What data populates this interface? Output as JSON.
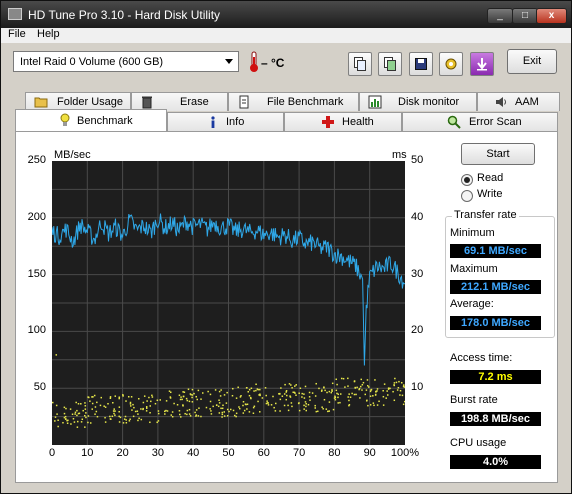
{
  "window": {
    "title": "HD Tune Pro 3.10 - Hard Disk Utility",
    "min": "_",
    "max": "□",
    "close": "x"
  },
  "menu": [
    "File",
    "Help"
  ],
  "toolbar": {
    "drive": "Intel   Raid 0 Volume (600 GB)",
    "temperature": "– °C",
    "exit_label": "Exit",
    "icons": [
      "copy-text-icon",
      "copy-screenshot-icon",
      "save-icon",
      "options-icon",
      "download-icon"
    ]
  },
  "tabs_row1": [
    "Folder Usage",
    "Erase",
    "File Benchmark",
    "Disk monitor",
    "AAM"
  ],
  "tabs_row2": [
    "Benchmark",
    "Info",
    "Health",
    "Error Scan"
  ],
  "active_tab": "Benchmark",
  "controls": {
    "start": "Start",
    "read": "Read",
    "write": "Write",
    "selected": "Read"
  },
  "results": {
    "transfer_rate": "Transfer rate",
    "minimum_label": "Minimum",
    "minimum": "69.1 MB/sec",
    "maximum_label": "Maximum",
    "maximum": "212.1 MB/sec",
    "average_label": "Average:",
    "average": "178.0 MB/sec",
    "access_label": "Access time:",
    "access": "7.2 ms",
    "burst_label": "Burst rate",
    "burst": "198.8 MB/sec",
    "cpu_label": "CPU usage",
    "cpu": "4.0%"
  },
  "colors": {
    "transfer_line": "#2fa8e8",
    "access_dots": "#e8e84a",
    "plot_bg": "#1e1e1e",
    "grid": "#4a4a4a"
  },
  "chart_data": {
    "type": "line",
    "ylabel_left": "MB/sec",
    "ylabel_right": "ms",
    "ylim_left": [
      0,
      250
    ],
    "ylim_right": [
      0,
      50
    ],
    "xlim": [
      0,
      100
    ],
    "left_ticks": [
      "250",
      "200",
      "150",
      "100",
      "50"
    ],
    "right_ticks": [
      "50",
      "40",
      "30",
      "20",
      "10"
    ],
    "x_ticks": [
      "0",
      "10",
      "20",
      "30",
      "40",
      "50",
      "60",
      "70",
      "80",
      "90",
      "100%"
    ],
    "grid": true,
    "series": [
      {
        "x": [
          0,
          2,
          4,
          6,
          8,
          10,
          12,
          14,
          16,
          18,
          20,
          22,
          24,
          26,
          28,
          30,
          32,
          34,
          36,
          38,
          40,
          42,
          44,
          46,
          48,
          50,
          52,
          54,
          56,
          58,
          60,
          62,
          64,
          66,
          68,
          70,
          72,
          74,
          76,
          78,
          80,
          82,
          84,
          86,
          87,
          88,
          88.5,
          89,
          90,
          92,
          94,
          96,
          98,
          100
        ],
        "values": [
          188,
          184,
          190,
          179,
          194,
          188,
          181,
          196,
          186,
          192,
          184,
          198,
          189,
          193,
          187,
          199,
          191,
          195,
          189,
          197,
          192,
          194,
          190,
          196,
          191,
          193,
          188,
          190,
          187,
          189,
          185,
          187,
          183,
          185,
          180,
          182,
          177,
          178,
          173,
          174,
          168,
          166,
          162,
          158,
          152,
          146,
          70,
          120,
          148,
          157,
          155,
          160,
          152,
          142
        ]
      }
    ],
    "access_time_ms": {
      "x_range": [
        0,
        100
      ],
      "min": [
        3,
        4,
        4,
        5,
        5,
        5,
        6,
        6,
        7,
        7
      ],
      "max": [
        8,
        9,
        9,
        10,
        10,
        11,
        11,
        11,
        12,
        12
      ],
      "bins": [
        0,
        10,
        20,
        30,
        40,
        50,
        60,
        70,
        80,
        90
      ],
      "outliers": [
        {
          "x": 1,
          "y": 16
        },
        {
          "x": 89,
          "y": 8
        },
        {
          "x": 92,
          "y": 10
        }
      ]
    }
  }
}
